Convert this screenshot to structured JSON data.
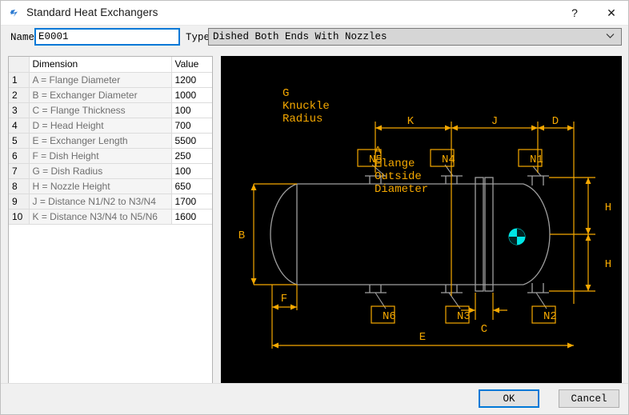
{
  "window": {
    "title": "Standard Heat Exchangers",
    "icon": "lightning-bolt-icon",
    "help_label": "?",
    "close_label": "✕"
  },
  "form": {
    "name_label": "Name",
    "name_value": "E0001",
    "name_placeholder": "",
    "type_label": "Type",
    "type_value": "Dished Both Ends With Nozzles",
    "type_arrow": "⌄"
  },
  "grid": {
    "headers": {
      "number": "",
      "dimension": "Dimension",
      "value": "Value"
    },
    "rows": [
      {
        "n": "1",
        "dimension": "A = Flange Diameter",
        "value": "1200"
      },
      {
        "n": "2",
        "dimension": "B = Exchanger Diameter",
        "value": "1000"
      },
      {
        "n": "3",
        "dimension": "C = Flange Thickness",
        "value": "100"
      },
      {
        "n": "4",
        "dimension": "D = Head Height",
        "value": "700"
      },
      {
        "n": "5",
        "dimension": "E = Exchanger Length",
        "value": "5500"
      },
      {
        "n": "6",
        "dimension": "F = Dish Height",
        "value": "250"
      },
      {
        "n": "7",
        "dimension": "G = Dish Radius",
        "value": "100"
      },
      {
        "n": "8",
        "dimension": "H = Nozzle Height",
        "value": "650"
      },
      {
        "n": "9",
        "dimension": "J = Distance N1/N2 to N3/N4",
        "value": "1700"
      },
      {
        "n": "10",
        "dimension": "K = Distance N3/N4 to N5/N6",
        "value": "1600"
      }
    ]
  },
  "diagram": {
    "background": "#000000",
    "dimension_color": "#f5a800",
    "geometry_color": "#a0a0a0",
    "marker_color": "#00e5e5",
    "labels": {
      "knuckle_g": "G",
      "knuckle_line1": "Knuckle",
      "knuckle_line2": "Radius",
      "flange_a": "A",
      "flange_line1": "Flange",
      "flange_line2": "Outside",
      "flange_line3": "Diameter",
      "dim_b": "B",
      "dim_c": "C",
      "dim_d": "D",
      "dim_e": "E",
      "dim_f": "F",
      "dim_h_upper": "H",
      "dim_h_lower": "H",
      "dim_j": "J",
      "dim_k": "K",
      "nozzle_n1": "N1",
      "nozzle_n2": "N2",
      "nozzle_n3": "N3",
      "nozzle_n4": "N4",
      "nozzle_n5": "N5",
      "nozzle_n6": "N6"
    }
  },
  "footer": {
    "ok_label": "OK",
    "cancel_label": "Cancel"
  }
}
